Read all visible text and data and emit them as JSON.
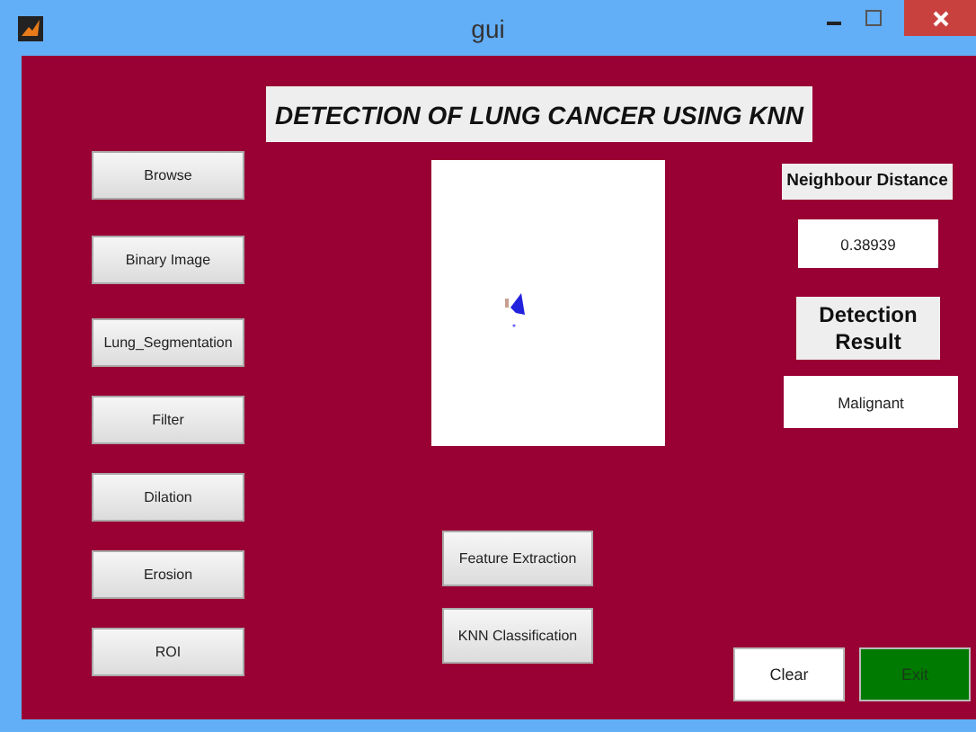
{
  "window": {
    "title": "gui"
  },
  "heading": "DETECTION OF LUNG CANCER USING KNN",
  "steps": [
    {
      "label": "Browse"
    },
    {
      "label": "Binary Image"
    },
    {
      "label": "Lung_Segmentation"
    },
    {
      "label": "Filter"
    },
    {
      "label": "Dilation"
    },
    {
      "label": "Erosion"
    },
    {
      "label": "ROI"
    }
  ],
  "analysis": [
    {
      "label": "Feature Extraction"
    },
    {
      "label": "KNN Classification"
    }
  ],
  "distance": {
    "label": "Neighbour Distance",
    "value": "0.38939"
  },
  "result": {
    "label": "Detection Result",
    "value": "Malignant"
  },
  "actions": [
    {
      "label": "Clear",
      "kind": "clear"
    },
    {
      "label": "Exit",
      "kind": "exit"
    }
  ]
}
